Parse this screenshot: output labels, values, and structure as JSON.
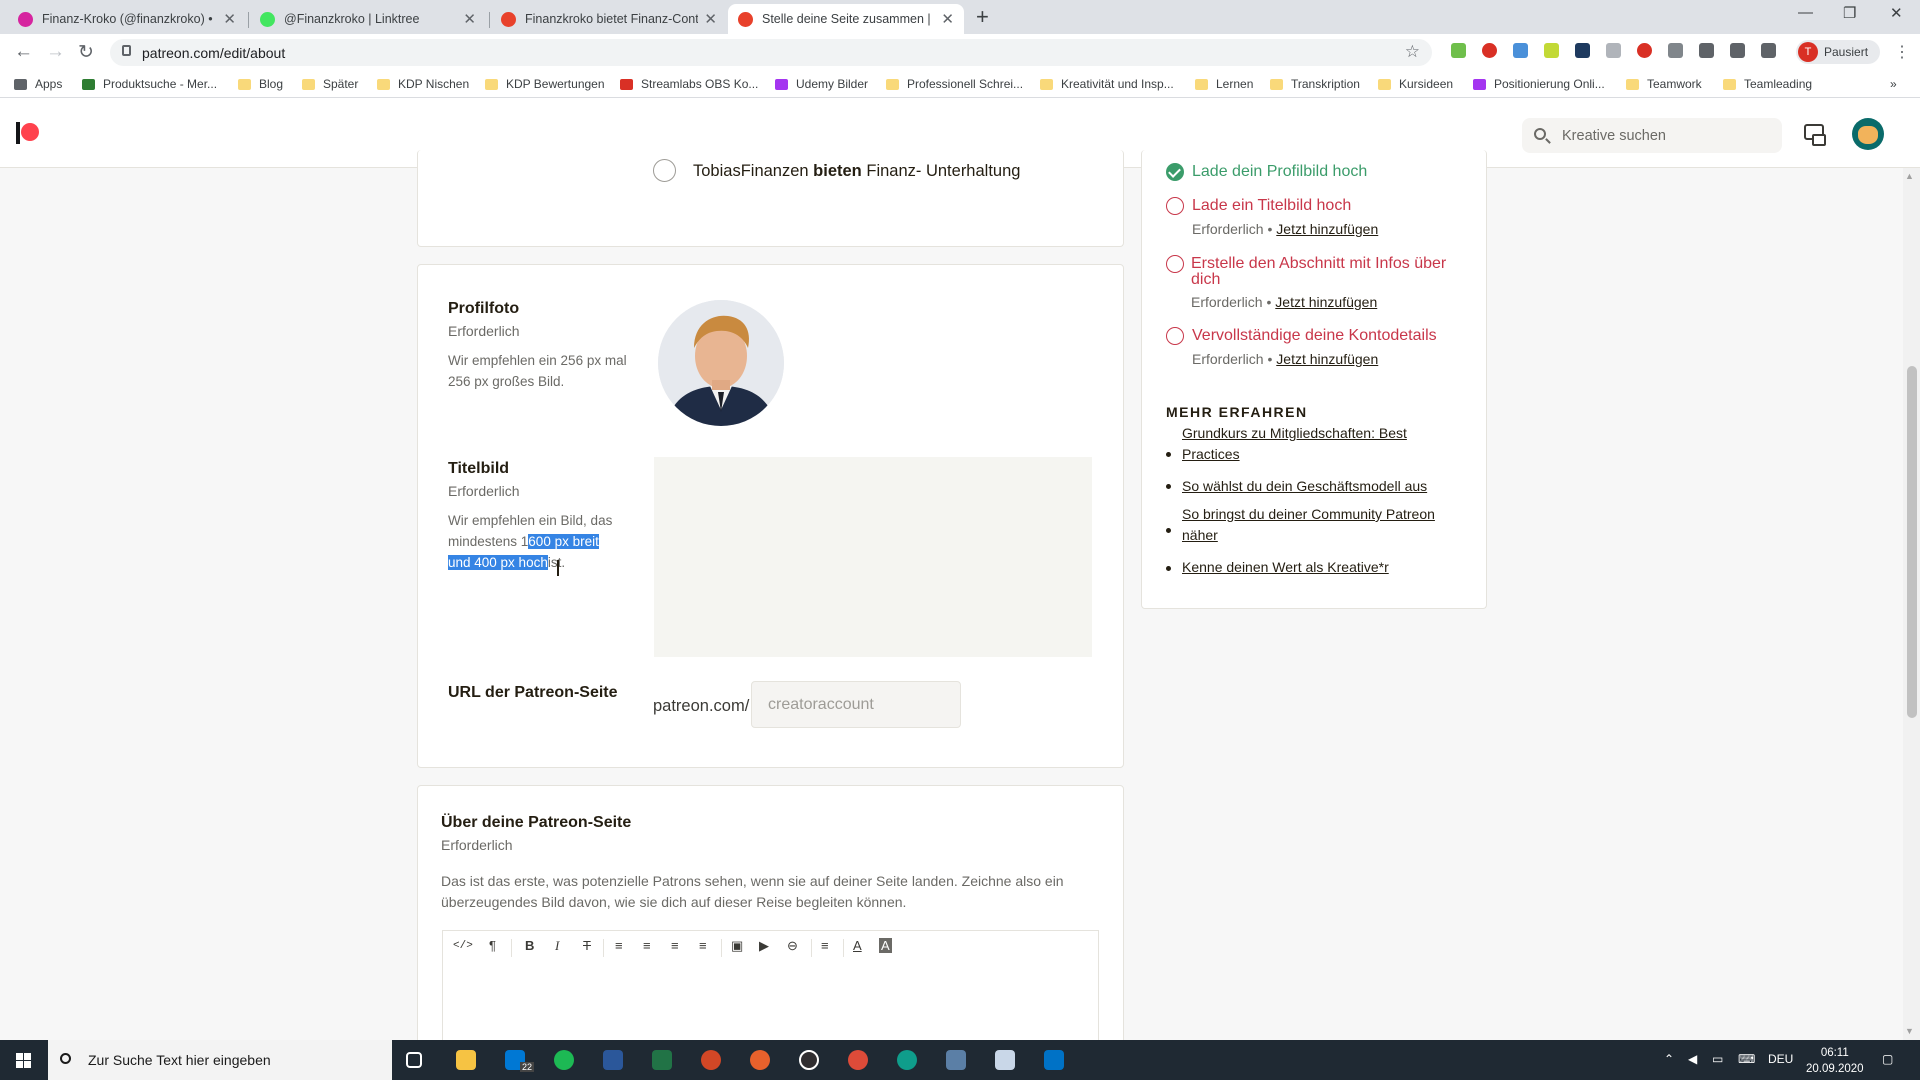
{
  "browser": {
    "tabs": [
      {
        "title": "Finanz-Kroko (@finanzkroko) • In",
        "favicon_color": "#d6249f"
      },
      {
        "title": "@Finanzkroko | Linktree",
        "favicon_color": "#43e660"
      },
      {
        "title": "Finanzkroko bietet Finanz-Conte",
        "favicon_color": "#e8412b"
      },
      {
        "title": "Stelle deine Seite zusammen | Pa",
        "favicon_color": "#e8412b"
      }
    ],
    "new_tab": "+",
    "url": "patreon.com/edit/about",
    "profile_initial": "T",
    "profile_label": "Pausiert",
    "bookmarks": [
      "Apps",
      "Produktsuche - Mer...",
      "Blog",
      "Später",
      "KDP Nischen",
      "KDP Bewertungen",
      "Streamlabs OBS Ko...",
      "Udemy Bilder",
      "Professionell Schrei...",
      "Kreativität und Insp...",
      "Lernen",
      "Transkription",
      "Kursideen",
      "Positionierung Onli...",
      "Teamwork",
      "Teamleading"
    ]
  },
  "header": {
    "search_placeholder": "Kreative suchen"
  },
  "offer_option": {
    "name": "TobiasFinanzen",
    "verb": "bieten",
    "rest": "Finanz- Unterhaltung"
  },
  "profile_photo": {
    "title": "Profilfoto",
    "required": "Erforderlich",
    "desc_line1": "Wir empfehlen ein 256 px mal",
    "desc_line2": "256 px großes Bild."
  },
  "cover_image": {
    "title": "Titelbild",
    "required": "Erforderlich",
    "desc_1": "Wir empfehlen ein Bild, das",
    "desc_2a": "mindestens 1",
    "desc_2b": "600 px breit",
    "desc_3a": "und 400 px hoch",
    "desc_3b": "ist."
  },
  "page_url": {
    "title": "URL der Patreon-Seite",
    "prefix": "patreon.com/",
    "placeholder": "creatoraccount"
  },
  "about": {
    "title": "Über deine Patreon-Seite",
    "required": "Erforderlich",
    "desc_1": "Das ist das erste, was potenzielle Patrons sehen, wenn sie auf deiner Seite landen. Zeichne also ein",
    "desc_2": "überzeugendes Bild davon, wie sie dich auf dieser Reise begleiten können."
  },
  "editor_toolbar": [
    "</>",
    "¶",
    "B",
    "I",
    "T",
    "≡",
    "≡",
    "≡",
    "≡",
    "▣",
    "▶",
    "⊖",
    "≡",
    "A",
    "A"
  ],
  "checklist": {
    "tasks": [
      {
        "title": "Lade dein Profilbild hoch",
        "done": true
      },
      {
        "title": "Lade ein Titelbild hoch",
        "sub": "Erforderlich",
        "link": "Jetzt hinzufügen"
      },
      {
        "title_1": "Erstelle den Abschnitt mit Infos über",
        "title_2": "dich",
        "sub": "Erforderlich",
        "link": "Jetzt hinzufügen"
      },
      {
        "title": "Vervollständige deine Kontodetails",
        "sub": "Erforderlich",
        "link": "Jetzt hinzufügen"
      }
    ],
    "learn_heading": "MEHR ERFAHREN",
    "learn_links": [
      {
        "l1": "Grundkurs zu Mitgliedschaften: Best",
        "l2": "Practices"
      },
      {
        "l1": "So wählst du dein Geschäftsmodell aus"
      },
      {
        "l1": "So bringst du deiner Community Patreon",
        "l2": "näher"
      },
      {
        "l1": "Kenne deinen Wert als Kreative*r"
      }
    ]
  },
  "taskbar": {
    "search_placeholder": "Zur Suche Text hier eingeben",
    "mail_badge": "22",
    "language": "DEU",
    "time": "06:11",
    "date": "20.09.2020"
  },
  "colors": {
    "patreon_red": "#ff424d",
    "task_red": "#c8374a",
    "done_green": "#3b9c6a",
    "selection_blue": "#3584e4"
  }
}
